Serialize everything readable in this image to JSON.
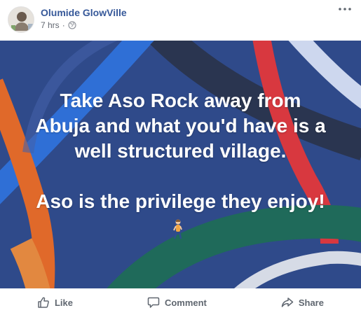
{
  "post": {
    "author": "Olumide GlowVille",
    "time": "7 hrs",
    "separator": "·",
    "privacy_icon": "globe-icon",
    "more_icon": "more-options-icon",
    "text_line_1": "Take Aso Rock away from",
    "text_line_2": "Abuja and what you'd have is a",
    "text_line_3": "well structured village.",
    "text_line_4": "Aso is the privilege they enjoy!",
    "emoji": "person-walking-icon",
    "colors": {
      "author": "#365899",
      "background": "#2f4a8a",
      "text": "#ffffff",
      "action_text": "#606770"
    }
  },
  "actions": {
    "like_label": "Like",
    "comment_label": "Comment",
    "share_label": "Share"
  }
}
